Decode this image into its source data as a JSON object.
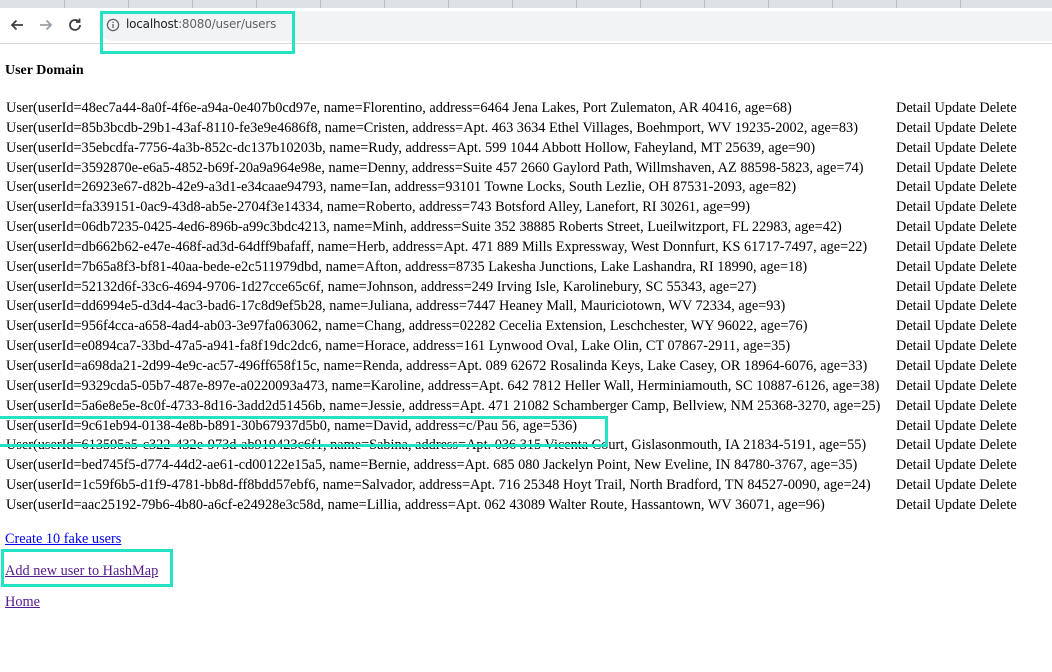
{
  "browser": {
    "url_host": "localhost",
    "url_rest": ":8080/user/users"
  },
  "page": {
    "heading": "User Domain"
  },
  "users": [
    {
      "text": "User(userId=48ec7a44-8a0f-4f6e-a94a-0e407b0cd97e, name=Florentino, address=6464 Jena Lakes, Port Zulematon, AR 40416, age=68)"
    },
    {
      "text": "User(userId=85b3bcdb-29b1-43af-8110-fe3e9e4686f8, name=Cristen, address=Apt. 463 3634 Ethel Villages, Boehmport, WV 19235-2002, age=83)"
    },
    {
      "text": "User(userId=35ebcdfa-7756-4a3b-852c-dc137b10203b, name=Rudy, address=Apt. 599 1044 Abbott Hollow, Faheyland, MT 25639, age=90)"
    },
    {
      "text": "User(userId=3592870e-e6a5-4852-b69f-20a9a964e98e, name=Denny, address=Suite 457 2660 Gaylord Path, Willmshaven, AZ 88598-5823, age=74)"
    },
    {
      "text": "User(userId=26923e67-d82b-42e9-a3d1-e34caae94793, name=Ian, address=93101 Towne Locks, South Lezlie, OH 87531-2093, age=82)"
    },
    {
      "text": "User(userId=fa339151-0ac9-43d8-ab5e-2704f3e14334, name=Roberto, address=743 Botsford Alley, Lanefort, RI 30261, age=99)"
    },
    {
      "text": "User(userId=06db7235-0425-4ed6-896b-a99c3bdc4213, name=Minh, address=Suite 352 38885 Roberts Street, Lueilwitzport, FL 22983, age=42)"
    },
    {
      "text": "User(userId=db662b62-e47e-468f-ad3d-64dff9bafaff, name=Herb, address=Apt. 471 889 Mills Expressway, West Donnfurt, KS 61717-7497, age=22)"
    },
    {
      "text": "User(userId=7b65a8f3-bf81-40aa-bede-e2c511979dbd, name=Afton, address=8735 Lakesha Junctions, Lake Lashandra, RI 18990, age=18)"
    },
    {
      "text": "User(userId=52132d6f-33c6-4694-9706-1d27cce65c6f, name=Johnson, address=249 Irving Isle, Karolinebury, SC 55343, age=27)"
    },
    {
      "text": "User(userId=dd6994e5-d3d4-4ac3-bad6-17c8d9ef5b28, name=Juliana, address=7447 Heaney Mall, Mauriciotown, WV 72334, age=93)"
    },
    {
      "text": "User(userId=956f4cca-a658-4ad4-ab03-3e97fa063062, name=Chang, address=02282 Cecelia Extension, Leschchester, WY 96022, age=76)"
    },
    {
      "text": "User(userId=e0894ca7-33bd-47a5-a941-fa8f19dc2dc6, name=Horace, address=161 Lynwood Oval, Lake Olin, CT 07867-2911, age=35)"
    },
    {
      "text": "User(userId=a698da21-2d99-4e9c-ac57-496ff658f15c, name=Renda, address=Apt. 089 62672 Rosalinda Keys, Lake Casey, OR 18964-6076, age=33)"
    },
    {
      "text": "User(userId=9329cda5-05b7-487e-897e-a0220093a473, name=Karoline, address=Apt. 642 7812 Heller Wall, Herminiamouth, SC 10887-6126, age=38)"
    },
    {
      "text": "User(userId=5a6e8e5e-8c0f-4733-8d16-3add2d51456b, name=Jessie, address=Apt. 471 21082 Schamberger Camp, Bellview, NM 25368-3270, age=25)"
    },
    {
      "text": "User(userId=9c61eb94-0138-4e8b-b891-30b67937d5b0, name=David, address=c/Pau 56, age=536)"
    },
    {
      "text": "User(userId=613595a5-c322-432e-973d-ab919423c6f1, name=Sabina, address=Apt. 036 315 Vicenta Court, Gislasonmouth, IA 21834-5191, age=55)"
    },
    {
      "text": "User(userId=bed745f5-d774-44d2-ae61-cd00122e15a5, name=Bernie, address=Apt. 685 080 Jackelyn Point, New Eveline, IN 84780-3767, age=35)"
    },
    {
      "text": "User(userId=1c59f6b5-d1f9-4781-bb8d-ff8bdd57ebf6, name=Salvador, address=Apt. 716 25348 Hoyt Trail, North Bradford, TN 84527-0090, age=24)"
    },
    {
      "text": "User(userId=aac25192-79b6-4b80-a6cf-e24928e3c58d, name=Lillia, address=Apt. 062 43089 Walter Route, Hassantown, WV 36071, age=96)"
    }
  ],
  "row_actions": {
    "detail": "Detail",
    "update": "Update",
    "delete": "Delete"
  },
  "links": {
    "create_fake": "Create 10 fake users",
    "add_new": "Add new user to HashMap",
    "home": "Home"
  },
  "colors": {
    "highlight": "#24e3c4",
    "link": "#0000ee",
    "visited_link": "#551a8b"
  }
}
